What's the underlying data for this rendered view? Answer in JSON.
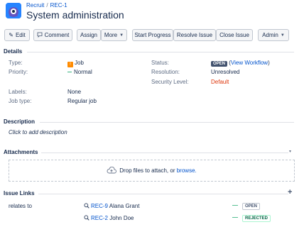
{
  "header": {
    "breadcrumb": [
      "Recruit",
      "REC-1"
    ],
    "breadcrumb_sep": "/",
    "title": "System administration"
  },
  "toolbar": {
    "edit": "Edit",
    "comment": "Comment",
    "assign": "Assign",
    "more": "More",
    "start_progress": "Start Progress",
    "resolve_issue": "Resolve Issue",
    "close_issue": "Close Issue",
    "admin": "Admin"
  },
  "details": {
    "heading": "Details",
    "type_label": "Type:",
    "type_value": "Job",
    "priority_label": "Priority:",
    "priority_value": "Normal",
    "labels_label": "Labels:",
    "labels_value": "None",
    "jobtype_label": "Job type:",
    "jobtype_value": "Regular job",
    "status_label": "Status:",
    "status_value": "OPEN",
    "view_workflow_open": "(",
    "view_workflow": "View Workflow",
    "view_workflow_close": ")",
    "resolution_label": "Resolution:",
    "resolution_value": "Unresolved",
    "security_label": "Security Level:",
    "security_value": "Default"
  },
  "description": {
    "heading": "Description",
    "placeholder": "Click to add description"
  },
  "attachments": {
    "heading": "Attachments",
    "drop_text": "Drop files to attach, or",
    "browse": "browse."
  },
  "issue_links": {
    "heading": "Issue Links",
    "relation": "relates to",
    "items": [
      {
        "key": "REC-9",
        "name": "Alana Grant",
        "priority": "—",
        "status": "OPEN"
      },
      {
        "key": "REC-2",
        "name": "John Doe",
        "priority": "—",
        "status": "REJECTED"
      }
    ]
  },
  "colors": {
    "link": "#0052cc",
    "accent": "#2684ff",
    "danger": "#de350b",
    "job_type": "#ff8b00",
    "priority": "#36b37e"
  }
}
